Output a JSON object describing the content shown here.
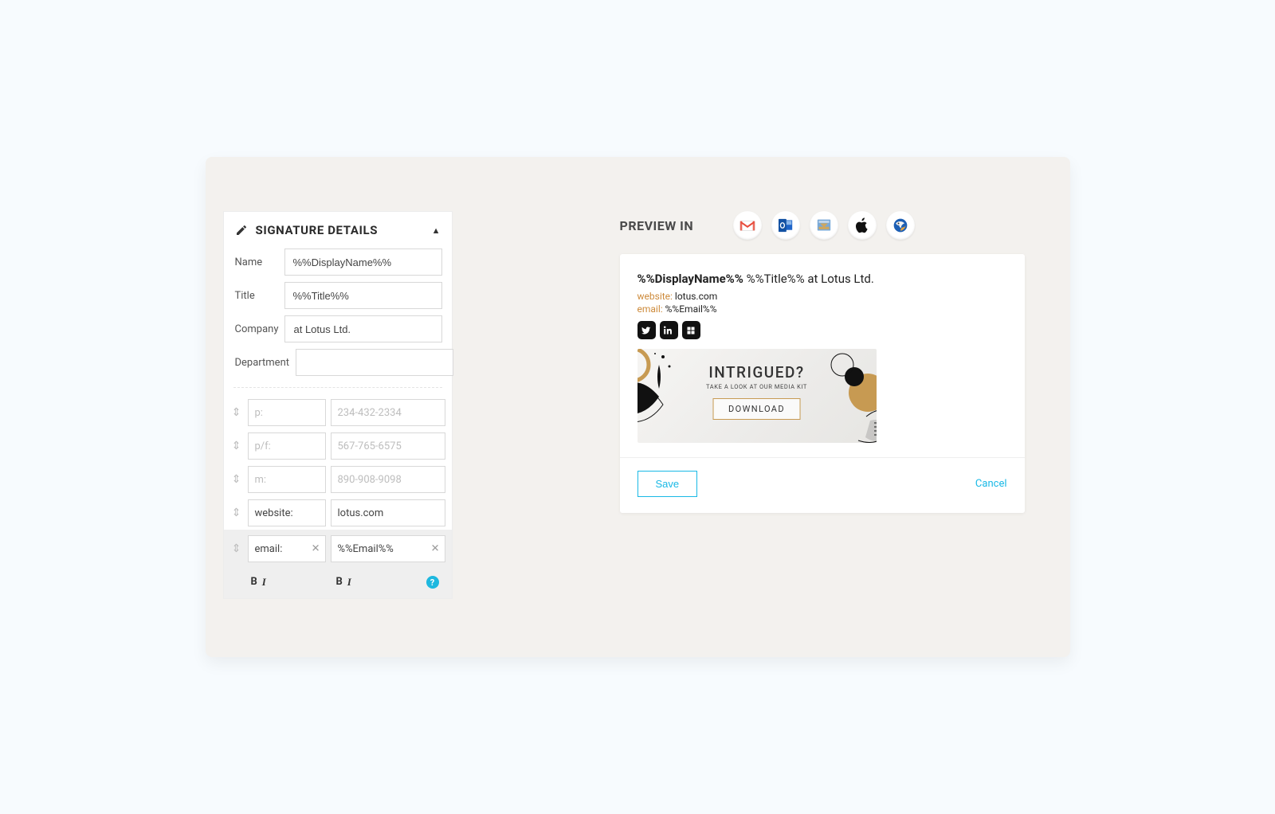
{
  "panel": {
    "title": "SIGNATURE DETAILS",
    "fields": {
      "name_label": "Name",
      "name_value": "%%DisplayName%%",
      "title_label": "Title",
      "title_value": "%%Title%%",
      "company_label": "Company",
      "company_value": "at Lotus Ltd.",
      "department_label": "Department",
      "department_value": ""
    },
    "contacts": [
      {
        "label": "p:",
        "label_placeholder": true,
        "value": "234-432-2334",
        "value_placeholder": true,
        "clearable": false
      },
      {
        "label": "p/f:",
        "label_placeholder": true,
        "value": "567-765-6575",
        "value_placeholder": true,
        "clearable": false
      },
      {
        "label": "m:",
        "label_placeholder": true,
        "value": "890-908-9098",
        "value_placeholder": true,
        "clearable": false
      },
      {
        "label": "website:",
        "label_placeholder": false,
        "value": "lotus.com",
        "value_placeholder": false,
        "clearable": false
      },
      {
        "label": "email:",
        "label_placeholder": false,
        "value": "%%Email%%",
        "value_placeholder": false,
        "clearable": true
      }
    ]
  },
  "preview": {
    "heading": "PREVIEW IN",
    "clients": [
      "gmail",
      "outlook",
      "mail",
      "apple",
      "thunderbird"
    ],
    "signature": {
      "display_name": "%%DisplayName%%",
      "title_suffix": "%%Title%% at Lotus Ltd.",
      "website_label": "website:",
      "website_value": "lotus.com",
      "email_label": "email:",
      "email_value": "%%Email%%",
      "social": [
        "twitter",
        "linkedin",
        "other"
      ]
    },
    "banner": {
      "title": "INTRIGUED?",
      "subtitle": "TAKE A LOOK AT OUR MEDIA KIT",
      "cta": "DOWNLOAD"
    },
    "actions": {
      "save": "Save",
      "cancel": "Cancel"
    }
  }
}
